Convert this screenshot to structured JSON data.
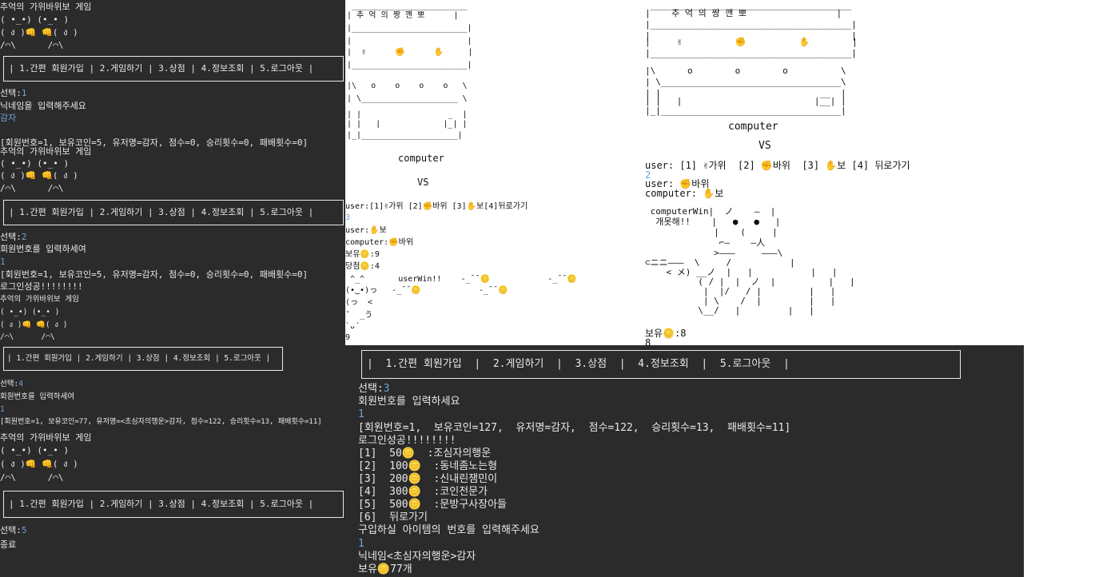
{
  "left": {
    "sessions": [
      {
        "title": "추억의 가위바위보 게임",
        "art": [
          "( •_•) (•_• )",
          "( ง )👊 👊( ง )",
          "/⌒\\      /⌒\\"
        ],
        "menu": "| 1.간편 회원가입 | 2.게임하기 | 3.상점 | 4.정보조회 | 5.로그아웃 |",
        "select_label": "선택:",
        "select_value": "1",
        "prompt": "닉네임을 입력해주세요",
        "input": "감자",
        "output": "[회원번호=1, 보유코인=5, 유저명=감자, 점수=0, 승리횟수=0, 패배횟수=0]"
      },
      {
        "title": "추억의 가위바위보 게임",
        "art": [
          "( •_•) (•_• )",
          "( ง )👊 👊( ง )",
          "/⌒\\      /⌒\\"
        ],
        "menu": "| 1.간편 회원가입 | 2.게임하기 | 3.상점 | 4.정보조회 | 5.로그아웃 |",
        "select_label": "선택:",
        "select_value": "2",
        "prompt": "회원번호를 입력하세여",
        "input": "1",
        "output": "[회원번호=1, 보유코인=5, 유저명=감자, 점수=0, 승리횟수=0, 패배횟수=0]",
        "extra": "로그인성공!!!!!!!!"
      },
      {
        "title": "추억의 가위바위보 게임",
        "art": [
          "( •_•) (•_• )",
          "( ง )👊 👊( ง )",
          "/⌒\\      /⌒\\"
        ],
        "menu": "| 1.간편 회원가입 | 2.게임하기 | 3.상점 | 4.정보조회 | 5.로그아웃 |",
        "select_label": "선택:",
        "select_value": "4",
        "prompt": "회원번호를 입력하세여",
        "input": "1",
        "output": "[회원번호=1, 보유코인=77, 유저명=<초심자의행운>감자, 점수=122, 승리횟수=13, 패배횟수=11]"
      },
      {
        "title": "추억의 가위바위보 게임",
        "art": [
          "( •_•) (•_• )",
          "( ง )👊 👊( ง )",
          "/⌒\\      /⌒\\"
        ],
        "menu": "| 1.간편 회원가입 | 2.게임하기 | 3.상점 | 4.정보조회 | 5.로그아웃 |",
        "select_label": "선택:",
        "select_value": "5",
        "prompt": "종료"
      }
    ]
  },
  "mid": {
    "machine_title": "| 추 억 의 짱 깬 뽀 |",
    "machine_art": [
      " ________________________",
      "| 추 억 의 짱 깬 뽀      |",
      "|________________________|",
      "|                        |",
      "|  ✌      ✊      ✋     |",
      "|________________________|",
      "|\\   o    o    o    o   \\",
      "| \\____________________ \\",
      "| |                  _  |",
      "| |   |             |_| |",
      "|_|____________________|"
    ],
    "computer_label": "computer",
    "vs_label": "VS",
    "user_menu": "user:[1]✌가위 [2]✊바위 [3]✋보[4]뒤로가기",
    "user_input": "3",
    "user_choice": "user:✋보",
    "computer_choice": "computer:✊바위",
    "coins": "보유🪙:9",
    "prize": "당첨🪙:4",
    "win_art": [
      " ^_^       userWin!!    -_¯¯🪙            -_¯¯🪙",
      "(•‿•)っ   -_¯¯🪙            -_¯¯🪙",
      "(っ  <",
      "ˇ  _う",
      "`ᴗ´"
    ],
    "tail": "9"
  },
  "right": {
    "machine_art": [
      " ______________________________________",
      "|    추 억 의 짱 깬 뽀                 |",
      "|______________________________________|",
      "|                                      |",
      "|     ✌          ✊          ✋        |",
      "|______________________________________|",
      "|\\      o        o        o          \\",
      "| \\__________________________________\\",
      "| |                              __  |",
      "| |   |                         |__| |",
      "|_|__________________________________|"
    ],
    "computer_label": "computer",
    "vs_label": "VS",
    "user_menu": "user: [1] ✌가위  [2] ✊바위  [3] ✋보 [4] 뒤로가기",
    "user_input": "2",
    "user_choice": "user: ✊바위",
    "computer_choice": "computer: ✋보",
    "lose_art": [
      " computerWin|  ノ    —  |",
      "  개못해!!    |   ●   ●   |",
      "             |    (     |",
      "              ⌐—    —人",
      "             >———     ———\\",
      "⊂ニニ———  \\     /           |",
      "    < メ) __ノ  |   |           |   |",
      "          ( / |  |  ノ  |          |   |",
      "           |  |/   / |         |   |",
      "           | \\    /  |         |   |",
      "          \\__/   |         |   |"
    ],
    "coins": "보유🪙:8",
    "tail": "8"
  },
  "bottom": {
    "menu": "|  1.간편 회원가입  |  2.게임하기  |  3.상점  |  4.정보조회  |  5.로그아웃  |",
    "select_label": "선택:",
    "select_value": "3",
    "prompt": "회원번호를 입력하세요",
    "input": "1",
    "output": "[회원번호=1,  보유코인=127,  유저명=감자,  점수=122,  승리횟수=13,  패배횟수=11]",
    "login": "로그인성공!!!!!!!!",
    "shop_items": [
      "[1]  50🪙  :조심자의행운",
      "[2]  100🪙  :동네좀노는형",
      "[3]  200🪙  :신내린잼민이",
      "[4]  300🪙  :코인전문가",
      "[5]  500🪙  :문방구사장아들",
      "[6]  뒤로가기"
    ],
    "buy_prompt": "구입하실 아이템의 번호를 입력해주세요",
    "buy_input": "1",
    "nickname": "닉네임<초심자의행운>감자",
    "remaining": "보유🪙77개"
  }
}
